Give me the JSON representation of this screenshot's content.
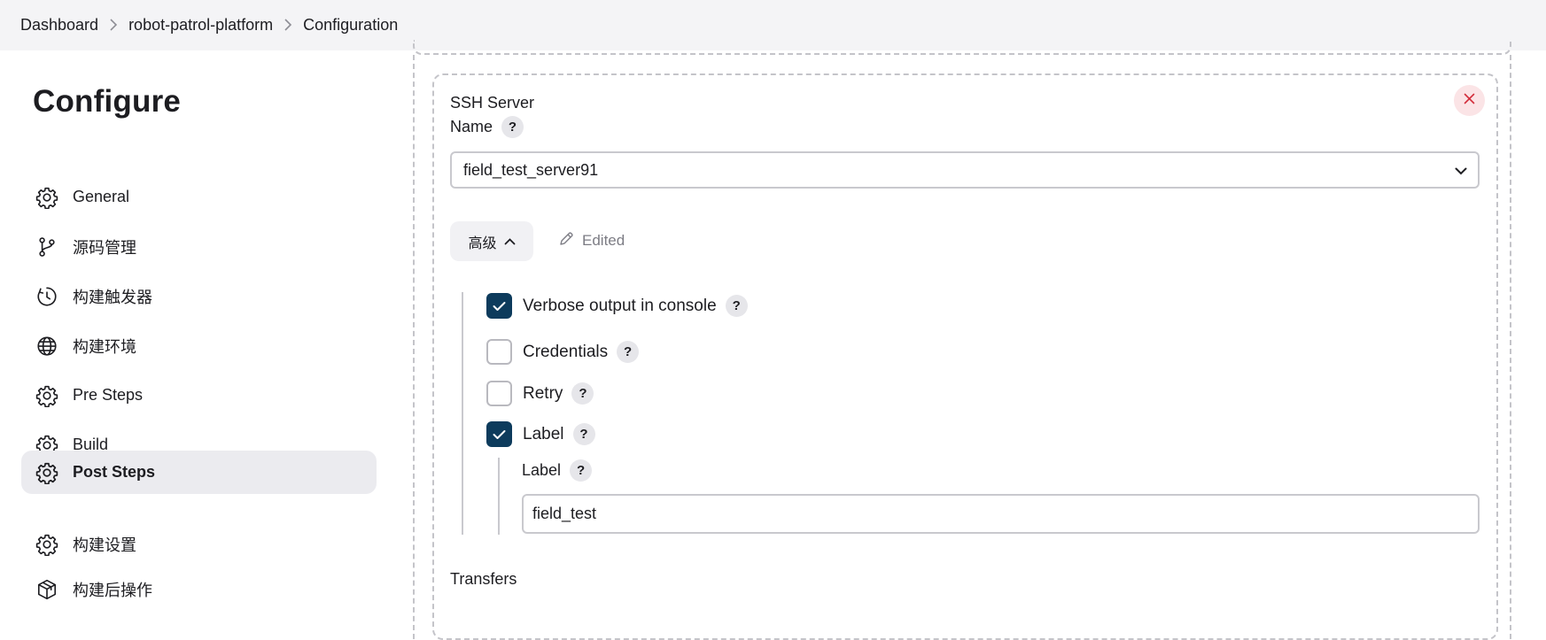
{
  "breadcrumb": [
    "Dashboard",
    "robot-patrol-platform",
    "Configuration"
  ],
  "sidebar": {
    "title": "Configure",
    "items": [
      {
        "label": "General",
        "icon": "gear-icon"
      },
      {
        "label": "源码管理",
        "icon": "branch-icon"
      },
      {
        "label": "构建触发器",
        "icon": "clock-icon"
      },
      {
        "label": "构建环境",
        "icon": "globe-icon"
      },
      {
        "label": "Pre Steps",
        "icon": "gear-icon"
      },
      {
        "label": "Build",
        "icon": "gear-icon"
      },
      {
        "label": "Post Steps",
        "icon": "gear-icon",
        "active": true
      },
      {
        "label": "构建设置",
        "icon": "gear-icon"
      },
      {
        "label": "构建后操作",
        "icon": "package-icon"
      }
    ]
  },
  "ssh_server": {
    "section_label": "SSH Server",
    "name_label": "Name",
    "name_value": "field_test_server91",
    "advanced_label": "高级",
    "edited_label": "Edited",
    "verbose_label": "Verbose output in console",
    "verbose_checked": true,
    "credentials_label": "Credentials",
    "credentials_checked": false,
    "retry_label": "Retry",
    "retry_checked": false,
    "label_checkbox_label": "Label",
    "label_checked": true,
    "label_field_label": "Label",
    "label_value": "field_test",
    "transfers_label": "Transfers",
    "help_glyph": "?"
  },
  "colors": {
    "checkbox_on": "#0d3b5c",
    "active_nav": "#ebebef",
    "close_bg": "#fbe4e6",
    "close_x": "#d22f3c"
  }
}
